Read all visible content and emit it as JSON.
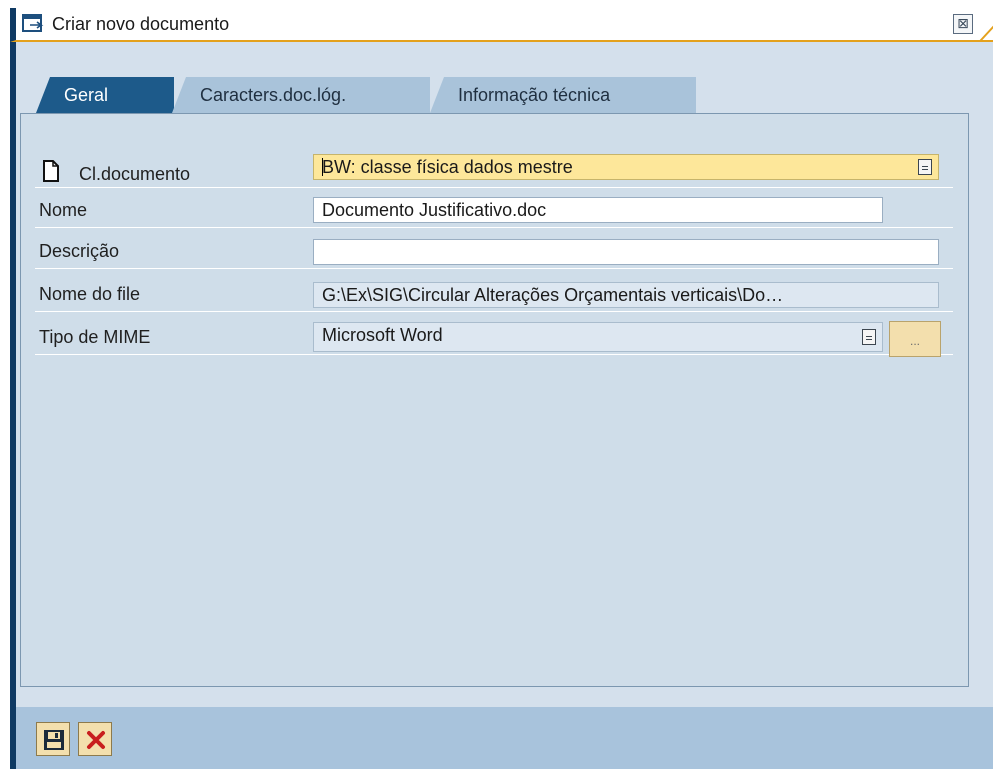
{
  "window": {
    "title": "Criar novo documento",
    "close_glyph": "⊠"
  },
  "tabs": [
    {
      "label": "Geral",
      "active": true
    },
    {
      "label": "Caracters.doc.lóg.",
      "active": false
    },
    {
      "label": "Informação técnica",
      "active": false
    }
  ],
  "form": {
    "cl_documento": {
      "label": "Cl.documento",
      "value": "BW: classe física dados mestre"
    },
    "nome": {
      "label": "Nome",
      "value": "Documento Justificativo.doc"
    },
    "descricao": {
      "label": "Descrição",
      "value": ""
    },
    "nome_file": {
      "label": "Nome do file",
      "value": "G:\\Ex\\SIG\\Circular Alterações Orçamentais verticais\\Do…"
    },
    "tipo_mime": {
      "label": "Tipo de MIME",
      "value": "Microsoft Word",
      "button_label": "..."
    }
  },
  "toolbar": {
    "save_icon": "save-icon",
    "cancel_icon": "cancel-icon"
  },
  "colors": {
    "title_accent": "#e4a11c",
    "window_border": "#0f3a63",
    "active_tab": "#1d5a8a",
    "required_field": "#fde79a",
    "panel": "#cfdde9"
  }
}
